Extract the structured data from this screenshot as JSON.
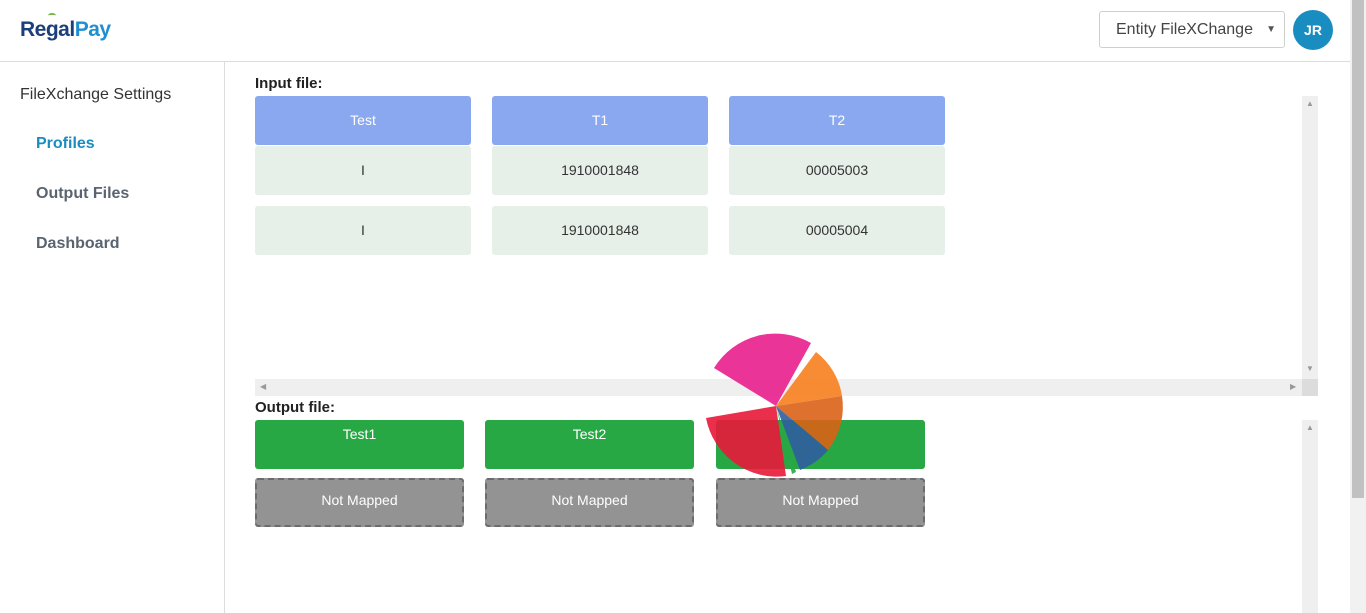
{
  "brand": {
    "part1": "Regal",
    "part2": "Pay"
  },
  "header": {
    "entity_select": "Entity FileXChange",
    "avatar_initials": "JR"
  },
  "sidebar": {
    "title": "FileXchange Settings",
    "items": [
      {
        "label": "Profiles",
        "active": true
      },
      {
        "label": "Output Files",
        "active": false
      },
      {
        "label": "Dashboard",
        "active": false
      }
    ]
  },
  "input_file": {
    "label": "Input file:",
    "columns": [
      "Test",
      "T1",
      "T2"
    ],
    "rows": [
      [
        "I",
        "1910001848",
        "00005003"
      ],
      [
        "I",
        "1910001848",
        "00005004"
      ]
    ]
  },
  "output_file": {
    "label": "Output file:",
    "columns": [
      "Test1",
      "Test2",
      ""
    ],
    "mappings": [
      "Not Mapped",
      "Not Mapped",
      "Not Mapped"
    ]
  },
  "colors": {
    "brand_dark": "#1a3f7a",
    "brand_light": "#1e8fd0",
    "active_nav": "#1a8dc0",
    "input_header": "#8aa8ef",
    "input_cell": "#e6efe8",
    "output_header": "#28a745",
    "not_mapped": "#939393"
  }
}
